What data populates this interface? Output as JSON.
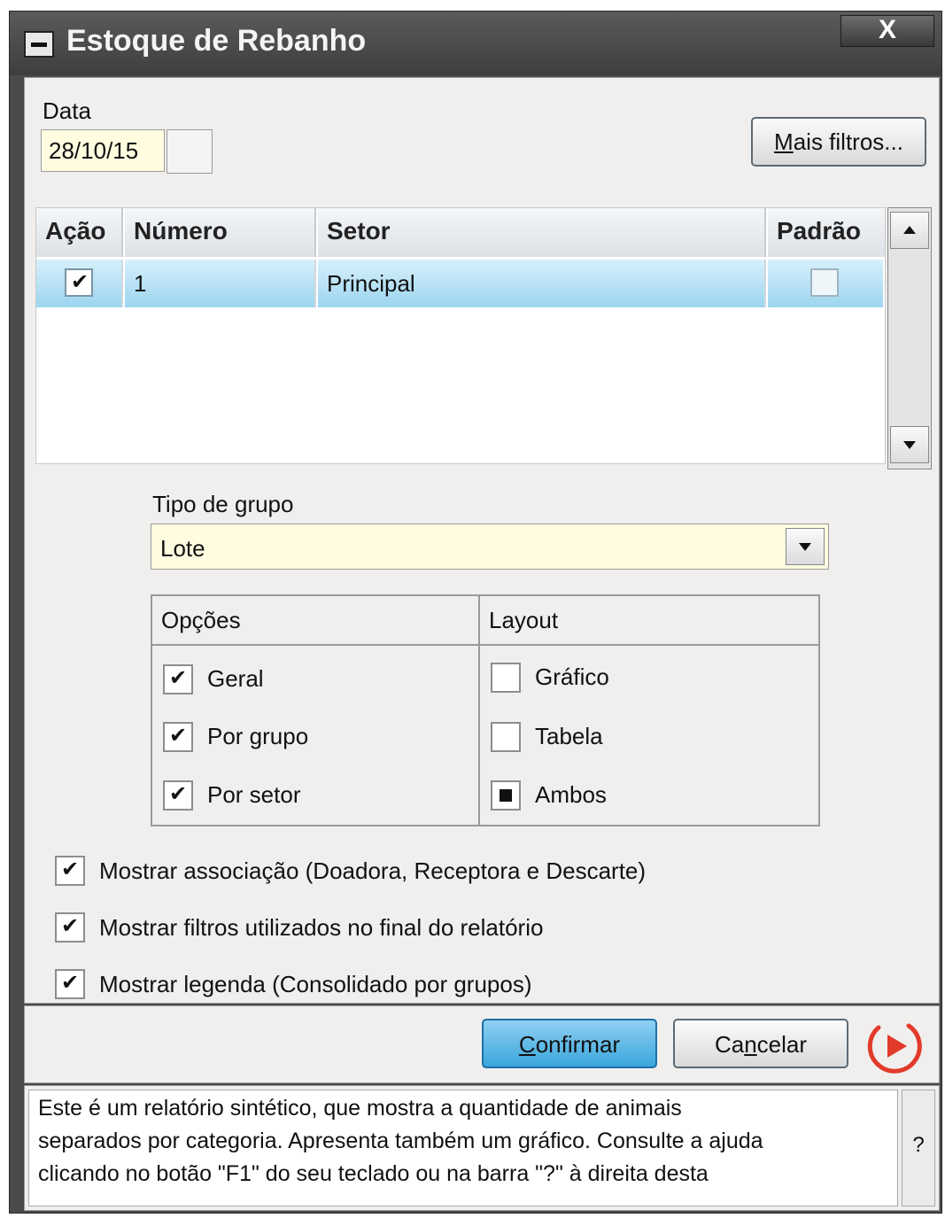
{
  "window": {
    "title": "Estoque de Rebanho",
    "close_glyph": "X"
  },
  "date": {
    "label": "Data",
    "value": "28/10/15"
  },
  "more_filters": {
    "underlined": "M",
    "rest": "ais filtros..."
  },
  "grid": {
    "headers": [
      "Ação",
      "Número",
      "Setor",
      "Padrão"
    ],
    "rows": [
      {
        "acao": true,
        "numero": "1",
        "setor": "Principal",
        "padrao": false
      }
    ]
  },
  "group_type": {
    "label": "Tipo de grupo",
    "value": "Lote"
  },
  "options": {
    "header": "Opções",
    "items": [
      {
        "label": "Geral",
        "checked": true
      },
      {
        "label": "Por grupo",
        "checked": true
      },
      {
        "label": "Por setor",
        "checked": true
      }
    ]
  },
  "layout": {
    "header": "Layout",
    "items": [
      {
        "label": "Gráfico",
        "checked": false
      },
      {
        "label": "Tabela",
        "checked": false
      },
      {
        "label": "Ambos",
        "checked": true
      }
    ]
  },
  "flags": [
    {
      "label": "Mostrar associação (Doadora, Receptora e Descarte)",
      "checked": true
    },
    {
      "label": "Mostrar filtros utilizados no final do relatório",
      "checked": true
    },
    {
      "label": "Mostrar legenda (Consolidado por grupos)",
      "checked": true
    }
  ],
  "buttons": {
    "confirm": {
      "underlined": "C",
      "rest": "onfirmar"
    },
    "cancel": {
      "pre": "Ca",
      "underlined": "n",
      "rest": "celar"
    }
  },
  "help": {
    "lines": [
      "Este é um relatório sintético, que mostra a quantidade de animais",
      "separados por categoria. Apresenta também um gráfico. Consulte a ajuda",
      "clicando no botão \"F1\" do seu teclado ou na barra \"?\" à direita desta"
    ],
    "question": "?"
  },
  "colors": {
    "accent": "#3aa6dc",
    "play": "#e23a2a",
    "input_bg": "#fffce0"
  }
}
